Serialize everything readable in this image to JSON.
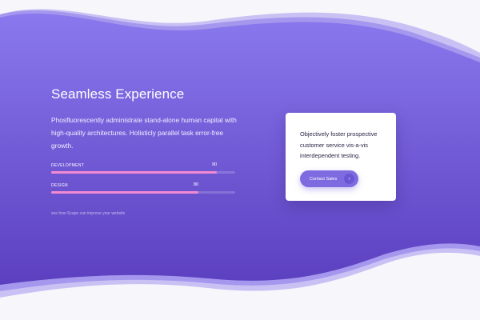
{
  "hero": {
    "title": "Seamless Experience",
    "description": "Phosfluorescently administrate stand-alone human capital with high-quality architectures. Holisticly parallel task error-free growth.",
    "skills": [
      {
        "label": "DEVELOPMENT",
        "value": "90",
        "percent": 90
      },
      {
        "label": "DESIGN",
        "value": "80",
        "percent": 80
      }
    ],
    "footer_link": "see how Scape can improve your website"
  },
  "card": {
    "text": "Objectively foster prospective customer service vis-a-vis interdependent testing.",
    "cta_label": "Contact Sales",
    "cta_arrow": "›"
  },
  "colors": {
    "accent": "#7f6be0",
    "progress_fill": "#f28ad2",
    "background": "#f7f7fb"
  }
}
